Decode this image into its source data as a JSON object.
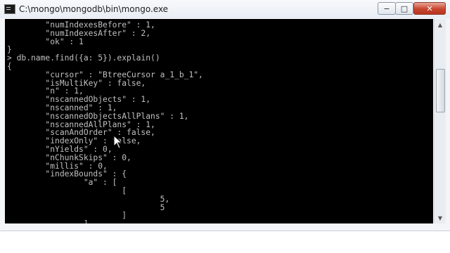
{
  "window": {
    "title": "C:\\mongo\\mongodb\\bin\\mongo.exe",
    "minimize_label": "−",
    "maximize_label": "□",
    "close_label": "✕"
  },
  "console": {
    "lines": [
      "        \"numIndexesBefore\" : 1,",
      "        \"numIndexesAfter\" : 2,",
      "        \"ok\" : 1",
      "}",
      "> db.name.find({a: 5}).explain()",
      "{",
      "        \"cursor\" : \"BtreeCursor a_1_b_1\",",
      "        \"isMultiKey\" : false,",
      "        \"n\" : 1,",
      "        \"nscannedObjects\" : 1,",
      "        \"nscanned\" : 1,",
      "        \"nscannedObjectsAllPlans\" : 1,",
      "        \"nscannedAllPlans\" : 1,",
      "        \"scanAndOrder\" : false,",
      "        \"indexOnly\" : false,",
      "        \"nYields\" : 0,",
      "        \"nChunkSkips\" : 0,",
      "        \"millis\" : 0,",
      "        \"indexBounds\" : {",
      "                \"a\" : [",
      "                        [",
      "                                5,",
      "                                5",
      "                        ]",
      "                ],"
    ]
  },
  "scrollbar": {
    "up_icon": "▲",
    "down_icon": "▼"
  }
}
